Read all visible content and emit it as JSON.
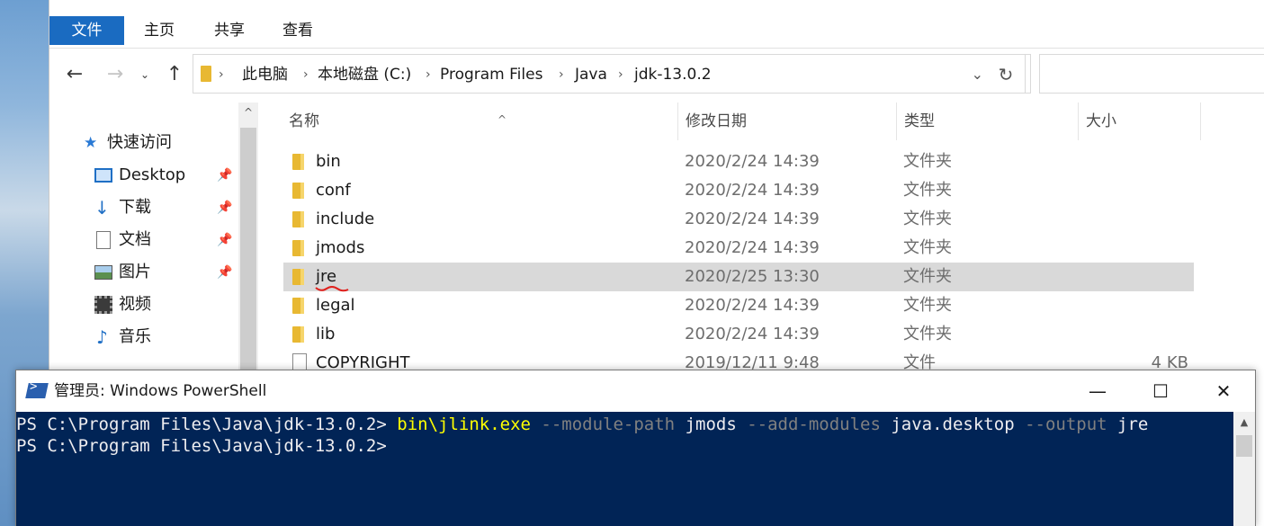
{
  "ribbon": {
    "tabs": [
      "文件",
      "主页",
      "共享",
      "查看"
    ]
  },
  "address": {
    "crumbs": [
      "此电脑",
      "本地磁盘 (C:)",
      "Program Files",
      "Java",
      "jdk-13.0.2"
    ]
  },
  "navpane": {
    "quick_access": "快速访问",
    "items": [
      {
        "label": "Desktop",
        "icon": "desktop-icon",
        "pinned": true
      },
      {
        "label": "下载",
        "icon": "download-icon",
        "pinned": true
      },
      {
        "label": "文档",
        "icon": "document-icon",
        "pinned": true
      },
      {
        "label": "图片",
        "icon": "picture-icon",
        "pinned": true
      },
      {
        "label": "视频",
        "icon": "video-icon",
        "pinned": false
      },
      {
        "label": "音乐",
        "icon": "music-icon",
        "pinned": false
      }
    ]
  },
  "columns": {
    "name": "名称",
    "date": "修改日期",
    "type": "类型",
    "size": "大小"
  },
  "files": [
    {
      "name": "bin",
      "date": "2020/2/24 14:39",
      "type": "文件夹",
      "size": ""
    },
    {
      "name": "conf",
      "date": "2020/2/24 14:39",
      "type": "文件夹",
      "size": ""
    },
    {
      "name": "include",
      "date": "2020/2/24 14:39",
      "type": "文件夹",
      "size": ""
    },
    {
      "name": "jmods",
      "date": "2020/2/24 14:39",
      "type": "文件夹",
      "size": ""
    },
    {
      "name": "jre",
      "date": "2020/2/25 13:30",
      "type": "文件夹",
      "size": "",
      "selected": true
    },
    {
      "name": "legal",
      "date": "2020/2/24 14:39",
      "type": "文件夹",
      "size": ""
    },
    {
      "name": "lib",
      "date": "2020/2/24 14:39",
      "type": "文件夹",
      "size": ""
    },
    {
      "name": "COPYRIGHT",
      "date": "2019/12/11 9:48",
      "type": "文件",
      "size": "4 KB"
    }
  ],
  "powershell": {
    "title": "管理员: Windows PowerShell",
    "minimize": "—",
    "maximize": "☐",
    "close": "✕",
    "prompt": "PS C:\\Program Files\\Java\\jdk-13.0.2> ",
    "command": "bin\\jlink.exe",
    "args": [
      {
        "text": " --module-path",
        "kind": "param"
      },
      {
        "text": " jmods",
        "kind": "arg"
      },
      {
        "text": " --add-modules",
        "kind": "param"
      },
      {
        "text": " java.desktop",
        "kind": "arg"
      },
      {
        "text": " --output",
        "kind": "param"
      },
      {
        "text": " jre",
        "kind": "arg"
      }
    ],
    "second_prompt": "PS C:\\Program Files\\Java\\jdk-13.0.2>"
  },
  "colors": {
    "accent": "#1a6bc1",
    "console_bg": "#012456",
    "console_cmd": "#ffff00",
    "console_param": "#808080",
    "selection": "#d9d9d9",
    "folder": "#e8b832"
  }
}
